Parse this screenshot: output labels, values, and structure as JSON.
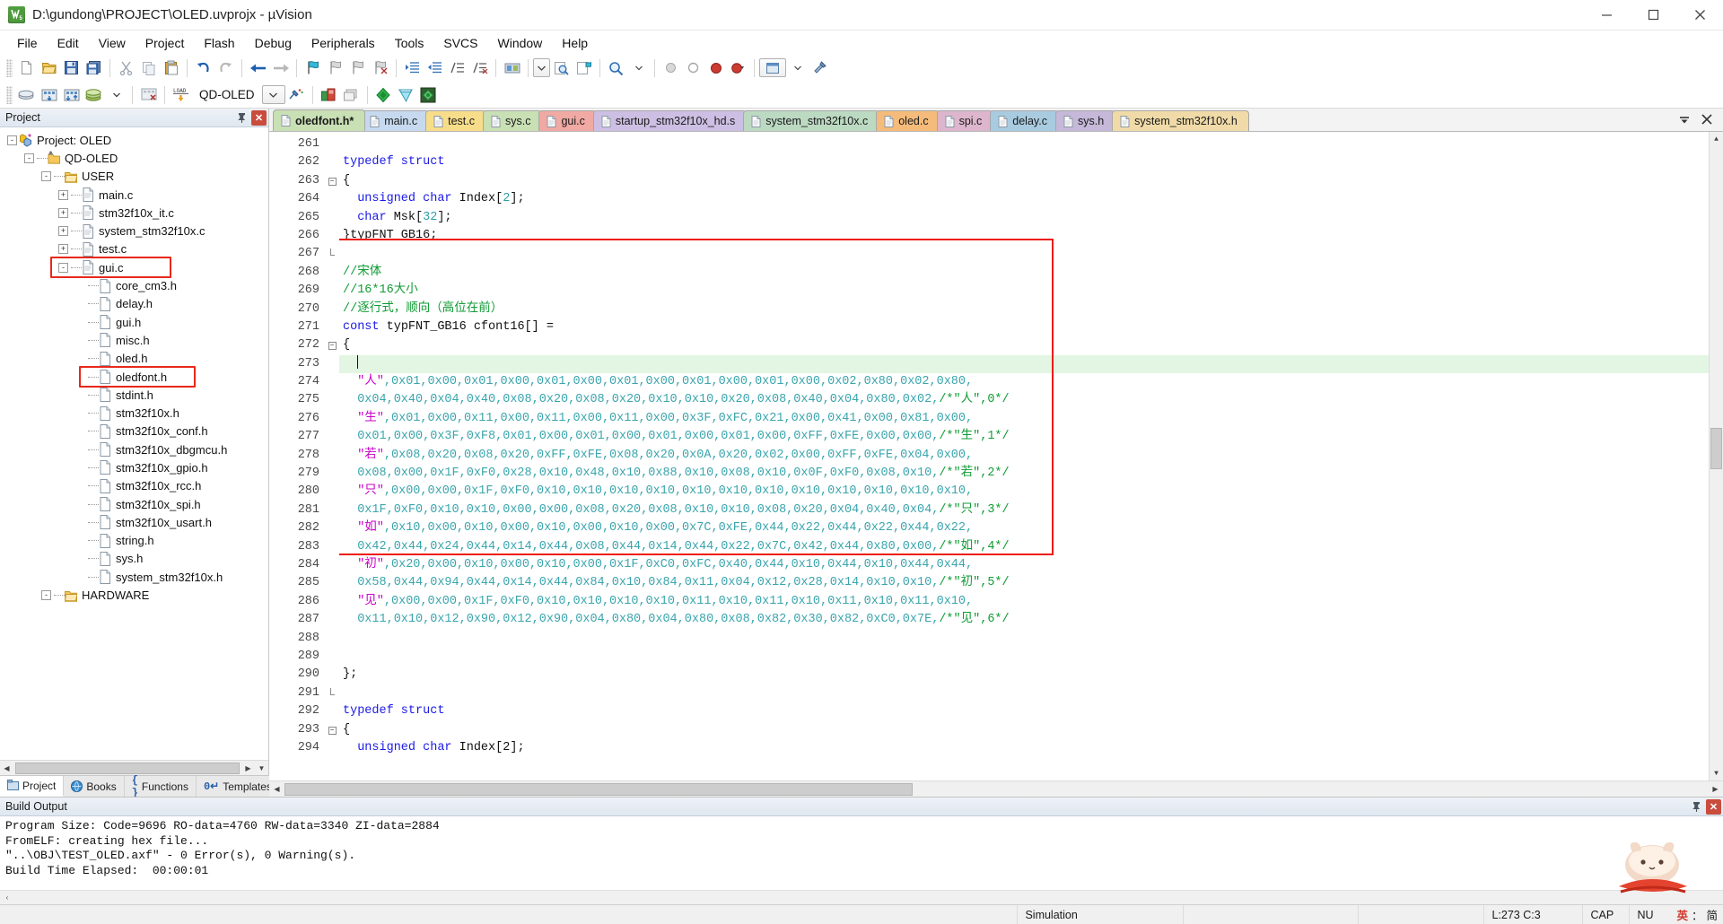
{
  "window": {
    "title": "D:\\gundong\\PROJECT\\OLED.uvprojx - µVision",
    "app_icon": "uvision-logo-icon",
    "minimize": "–",
    "maximize": "❐",
    "close": "✕"
  },
  "menu": [
    "File",
    "Edit",
    "View",
    "Project",
    "Flash",
    "Debug",
    "Peripherals",
    "Tools",
    "SVCS",
    "Window",
    "Help"
  ],
  "toolbar2": {
    "target_name": "QD-OLED"
  },
  "project_panel": {
    "title": "Project",
    "pin_icon": "pin-icon",
    "close_icon": "close-icon",
    "tree": [
      {
        "label": "Project: OLED",
        "depth": 0,
        "toggle": "-",
        "icon": "project-icon",
        "highlight": false
      },
      {
        "label": "QD-OLED",
        "depth": 1,
        "toggle": "-",
        "icon": "target-icon",
        "highlight": false
      },
      {
        "label": "USER",
        "depth": 2,
        "toggle": "-",
        "icon": "folder-icon",
        "highlight": false
      },
      {
        "label": "main.c",
        "depth": 3,
        "toggle": "+",
        "icon": "c-file-icon",
        "highlight": false
      },
      {
        "label": "stm32f10x_it.c",
        "depth": 3,
        "toggle": "+",
        "icon": "c-file-icon",
        "highlight": false
      },
      {
        "label": "system_stm32f10x.c",
        "depth": 3,
        "toggle": "+",
        "icon": "c-file-icon",
        "highlight": false
      },
      {
        "label": "test.c",
        "depth": 3,
        "toggle": "+",
        "icon": "c-file-icon",
        "highlight": false
      },
      {
        "label": "gui.c",
        "depth": 3,
        "toggle": "-",
        "icon": "c-file-icon",
        "highlight": true
      },
      {
        "label": "core_cm3.h",
        "depth": 4,
        "toggle": "",
        "icon": "h-file-icon",
        "highlight": false
      },
      {
        "label": "delay.h",
        "depth": 4,
        "toggle": "",
        "icon": "h-file-icon",
        "highlight": false
      },
      {
        "label": "gui.h",
        "depth": 4,
        "toggle": "",
        "icon": "h-file-icon",
        "highlight": false
      },
      {
        "label": "misc.h",
        "depth": 4,
        "toggle": "",
        "icon": "h-file-icon",
        "highlight": false
      },
      {
        "label": "oled.h",
        "depth": 4,
        "toggle": "",
        "icon": "h-file-icon",
        "highlight": false
      },
      {
        "label": "oledfont.h",
        "depth": 4,
        "toggle": "",
        "icon": "h-file-icon",
        "highlight": true
      },
      {
        "label": "stdint.h",
        "depth": 4,
        "toggle": "",
        "icon": "h-file-icon",
        "highlight": false
      },
      {
        "label": "stm32f10x.h",
        "depth": 4,
        "toggle": "",
        "icon": "h-file-icon",
        "highlight": false
      },
      {
        "label": "stm32f10x_conf.h",
        "depth": 4,
        "toggle": "",
        "icon": "h-file-icon",
        "highlight": false
      },
      {
        "label": "stm32f10x_dbgmcu.h",
        "depth": 4,
        "toggle": "",
        "icon": "h-file-icon",
        "highlight": false
      },
      {
        "label": "stm32f10x_gpio.h",
        "depth": 4,
        "toggle": "",
        "icon": "h-file-icon",
        "highlight": false
      },
      {
        "label": "stm32f10x_rcc.h",
        "depth": 4,
        "toggle": "",
        "icon": "h-file-icon",
        "highlight": false
      },
      {
        "label": "stm32f10x_spi.h",
        "depth": 4,
        "toggle": "",
        "icon": "h-file-icon",
        "highlight": false
      },
      {
        "label": "stm32f10x_usart.h",
        "depth": 4,
        "toggle": "",
        "icon": "h-file-icon",
        "highlight": false
      },
      {
        "label": "string.h",
        "depth": 4,
        "toggle": "",
        "icon": "h-file-icon",
        "highlight": false
      },
      {
        "label": "sys.h",
        "depth": 4,
        "toggle": "",
        "icon": "h-file-icon",
        "highlight": false
      },
      {
        "label": "system_stm32f10x.h",
        "depth": 4,
        "toggle": "",
        "icon": "h-file-icon",
        "highlight": false
      },
      {
        "label": "HARDWARE",
        "depth": 2,
        "toggle": "-",
        "icon": "folder-icon",
        "highlight": false
      }
    ],
    "bottom_tabs": [
      {
        "label": "Project",
        "icon": "project-tab-icon",
        "active": true
      },
      {
        "label": "Books",
        "icon": "books-tab-icon",
        "active": false
      },
      {
        "label": "Functions",
        "icon": "functions-tab-icon",
        "active": false
      },
      {
        "label": "Templates",
        "icon": "templates-tab-icon",
        "active": false
      }
    ]
  },
  "editor": {
    "tabs": [
      {
        "label": "oledfont.h*",
        "color": "#c9dfb4",
        "active": true
      },
      {
        "label": "main.c",
        "color": "#c6d9ef",
        "active": false
      },
      {
        "label": "test.c",
        "color": "#f7dd8a",
        "active": false
      },
      {
        "label": "sys.c",
        "color": "#c9dfb4",
        "active": false
      },
      {
        "label": "gui.c",
        "color": "#f0a9a3",
        "active": false
      },
      {
        "label": "startup_stm32f10x_hd.s",
        "color": "#cdbfe3",
        "active": false
      },
      {
        "label": "system_stm32f10x.c",
        "color": "#bcd9c2",
        "active": false
      },
      {
        "label": "oled.c",
        "color": "#f5bb7a",
        "active": false
      },
      {
        "label": "spi.c",
        "color": "#ddb6cd",
        "active": false
      },
      {
        "label": "delay.c",
        "color": "#a9cbe0",
        "active": false
      },
      {
        "label": "sys.h",
        "color": "#c5b8d8",
        "active": false
      },
      {
        "label": "system_stm32f10x.h",
        "color": "#f0dba8",
        "active": false
      }
    ],
    "tab_menu_icon": "tab-list-icon",
    "tab_close_icon": "tab-close-icon",
    "first_line_number": 261,
    "current_line": 273,
    "lines": [
      {
        "n": 261,
        "fold": "",
        "segs": []
      },
      {
        "n": 262,
        "fold": "",
        "segs": [
          {
            "t": "kw",
            "s": "typedef struct"
          }
        ]
      },
      {
        "n": 263,
        "fold": "-",
        "segs": [
          {
            "t": "pl",
            "s": "{"
          }
        ]
      },
      {
        "n": 264,
        "fold": "",
        "segs": [
          {
            "t": "pl",
            "s": "  "
          },
          {
            "t": "kw",
            "s": "unsigned char"
          },
          {
            "t": "pl",
            "s": " Index["
          },
          {
            "t": "num",
            "s": "2"
          },
          {
            "t": "pl",
            "s": "];"
          }
        ]
      },
      {
        "n": 265,
        "fold": "",
        "segs": [
          {
            "t": "pl",
            "s": "  "
          },
          {
            "t": "kw",
            "s": "char"
          },
          {
            "t": "pl",
            "s": " Msk["
          },
          {
            "t": "num",
            "s": "32"
          },
          {
            "t": "pl",
            "s": "];"
          }
        ]
      },
      {
        "n": 266,
        "fold": "",
        "segs": [
          {
            "t": "pl",
            "s": "}typFNT_GB16;"
          }
        ]
      },
      {
        "n": 267,
        "fold": "|",
        "segs": []
      },
      {
        "n": 268,
        "fold": "",
        "segs": [
          {
            "t": "cmt",
            "s": "//宋体"
          }
        ]
      },
      {
        "n": 269,
        "fold": "",
        "segs": [
          {
            "t": "cmt",
            "s": "//16*16大小"
          }
        ]
      },
      {
        "n": 270,
        "fold": "",
        "segs": [
          {
            "t": "cmt",
            "s": "//逐行式，顺向（高位在前）"
          }
        ]
      },
      {
        "n": 271,
        "fold": "",
        "segs": [
          {
            "t": "kw",
            "s": "const"
          },
          {
            "t": "pl",
            "s": " typFNT_GB16 cfont16[] ="
          }
        ]
      },
      {
        "n": 272,
        "fold": "-",
        "segs": [
          {
            "t": "pl",
            "s": "{"
          }
        ]
      },
      {
        "n": 273,
        "fold": "",
        "segs": [
          {
            "t": "pl",
            "s": "  "
          }
        ],
        "current": true
      },
      {
        "n": 274,
        "fold": "",
        "segs": [
          {
            "t": "pl",
            "s": "  "
          },
          {
            "t": "str",
            "s": "\"人\""
          },
          {
            "t": "hx",
            "s": ",0x01,0x00,0x01,0x00,0x01,0x00,0x01,0x00,0x01,0x00,0x01,0x00,0x02,0x80,0x02,0x80,"
          }
        ]
      },
      {
        "n": 275,
        "fold": "",
        "segs": [
          {
            "t": "hx",
            "s": "  0x04,0x40,0x04,0x40,0x08,0x20,0x08,0x20,0x10,0x10,0x20,0x08,0x40,0x04,0x80,0x02,"
          },
          {
            "t": "cmt",
            "s": "/*\"人\",0*/"
          }
        ]
      },
      {
        "n": 276,
        "fold": "",
        "segs": [
          {
            "t": "pl",
            "s": "  "
          },
          {
            "t": "str",
            "s": "\"生\""
          },
          {
            "t": "hx",
            "s": ",0x01,0x00,0x11,0x00,0x11,0x00,0x11,0x00,0x3F,0xFC,0x21,0x00,0x41,0x00,0x81,0x00,"
          }
        ]
      },
      {
        "n": 277,
        "fold": "",
        "segs": [
          {
            "t": "hx",
            "s": "  0x01,0x00,0x3F,0xF8,0x01,0x00,0x01,0x00,0x01,0x00,0x01,0x00,0xFF,0xFE,0x00,0x00,"
          },
          {
            "t": "cmt",
            "s": "/*\"生\",1*/"
          }
        ]
      },
      {
        "n": 278,
        "fold": "",
        "segs": [
          {
            "t": "pl",
            "s": "  "
          },
          {
            "t": "str",
            "s": "\"若\""
          },
          {
            "t": "hx",
            "s": ",0x08,0x20,0x08,0x20,0xFF,0xFE,0x08,0x20,0x0A,0x20,0x02,0x00,0xFF,0xFE,0x04,0x00,"
          }
        ]
      },
      {
        "n": 279,
        "fold": "",
        "segs": [
          {
            "t": "hx",
            "s": "  0x08,0x00,0x1F,0xF0,0x28,0x10,0x48,0x10,0x88,0x10,0x08,0x10,0x0F,0xF0,0x08,0x10,"
          },
          {
            "t": "cmt",
            "s": "/*\"若\",2*/"
          }
        ]
      },
      {
        "n": 280,
        "fold": "",
        "segs": [
          {
            "t": "pl",
            "s": "  "
          },
          {
            "t": "str",
            "s": "\"只\""
          },
          {
            "t": "hx",
            "s": ",0x00,0x00,0x1F,0xF0,0x10,0x10,0x10,0x10,0x10,0x10,0x10,0x10,0x10,0x10,0x10,0x10,"
          }
        ]
      },
      {
        "n": 281,
        "fold": "",
        "segs": [
          {
            "t": "hx",
            "s": "  0x1F,0xF0,0x10,0x10,0x00,0x00,0x08,0x20,0x08,0x10,0x10,0x08,0x20,0x04,0x40,0x04,"
          },
          {
            "t": "cmt",
            "s": "/*\"只\",3*/"
          }
        ]
      },
      {
        "n": 282,
        "fold": "",
        "segs": [
          {
            "t": "pl",
            "s": "  "
          },
          {
            "t": "str",
            "s": "\"如\""
          },
          {
            "t": "hx",
            "s": ",0x10,0x00,0x10,0x00,0x10,0x00,0x10,0x00,0x7C,0xFE,0x44,0x22,0x44,0x22,0x44,0x22,"
          }
        ]
      },
      {
        "n": 283,
        "fold": "",
        "segs": [
          {
            "t": "hx",
            "s": "  0x42,0x44,0x24,0x44,0x14,0x44,0x08,0x44,0x14,0x44,0x22,0x7C,0x42,0x44,0x80,0x00,"
          },
          {
            "t": "cmt",
            "s": "/*\"如\",4*/"
          }
        ]
      },
      {
        "n": 284,
        "fold": "",
        "segs": [
          {
            "t": "pl",
            "s": "  "
          },
          {
            "t": "str",
            "s": "\"初\""
          },
          {
            "t": "hx",
            "s": ",0x20,0x00,0x10,0x00,0x10,0x00,0x1F,0xC0,0xFC,0x40,0x44,0x10,0x44,0x10,0x44,0x44,"
          }
        ]
      },
      {
        "n": 285,
        "fold": "",
        "segs": [
          {
            "t": "hx",
            "s": "  0x58,0x44,0x94,0x44,0x14,0x44,0x84,0x10,0x84,0x11,0x04,0x12,0x28,0x14,0x10,0x10,"
          },
          {
            "t": "cmt",
            "s": "/*\"初\",5*/"
          }
        ]
      },
      {
        "n": 286,
        "fold": "",
        "segs": [
          {
            "t": "pl",
            "s": "  "
          },
          {
            "t": "str",
            "s": "\"见\""
          },
          {
            "t": "hx",
            "s": ",0x00,0x00,0x1F,0xF0,0x10,0x10,0x10,0x10,0x11,0x10,0x11,0x10,0x11,0x10,0x11,0x10,"
          }
        ]
      },
      {
        "n": 287,
        "fold": "",
        "segs": [
          {
            "t": "hx",
            "s": "  0x11,0x10,0x12,0x90,0x12,0x90,0x04,0x80,0x04,0x80,0x08,0x82,0x30,0x82,0xC0,0x7E,"
          },
          {
            "t": "cmt",
            "s": "/*\"见\",6*/"
          }
        ]
      },
      {
        "n": 288,
        "fold": "",
        "segs": []
      },
      {
        "n": 289,
        "fold": "",
        "segs": []
      },
      {
        "n": 290,
        "fold": "",
        "segs": [
          {
            "t": "pl",
            "s": "};"
          }
        ]
      },
      {
        "n": 291,
        "fold": "|",
        "segs": []
      },
      {
        "n": 292,
        "fold": "",
        "segs": [
          {
            "t": "kw",
            "s": "typedef struct"
          }
        ]
      },
      {
        "n": 293,
        "fold": "-",
        "segs": [
          {
            "t": "pl",
            "s": "{"
          }
        ]
      },
      {
        "n": 294,
        "fold": "",
        "segs": [
          {
            "t": "pl",
            "s": "  "
          },
          {
            "t": "kw",
            "s": "unsigned char"
          },
          {
            "t": "pl",
            "s": " Index[2];"
          }
        ]
      }
    ]
  },
  "build_output": {
    "title": "Build Output",
    "pin_icon": "pin-icon",
    "close_icon": "close-icon",
    "lines": [
      "Program Size: Code=9696 RO-data=4760 RW-data=3340 ZI-data=2884",
      "FromELF: creating hex file...",
      "\"..\\OBJ\\TEST_OLED.axf\" - 0 Error(s), 0 Warning(s).",
      "Build Time Elapsed:  00:00:01"
    ]
  },
  "statusbar": {
    "simulation": "Simulation",
    "cursor": "L:273 C:3",
    "caps": "CAP",
    "num": "NU",
    "ime_lang": "英",
    "ime_punct": "：",
    "ime_mode": "简"
  },
  "colors": {
    "keyword": "#1a1ae6",
    "comment": "#0f9b34",
    "string": "#c800c8",
    "hex": "#3aa5ad",
    "number": "#2f9ea4",
    "highlight_box": "#ee1c10",
    "current_line_bg": "#e3f6e3"
  }
}
